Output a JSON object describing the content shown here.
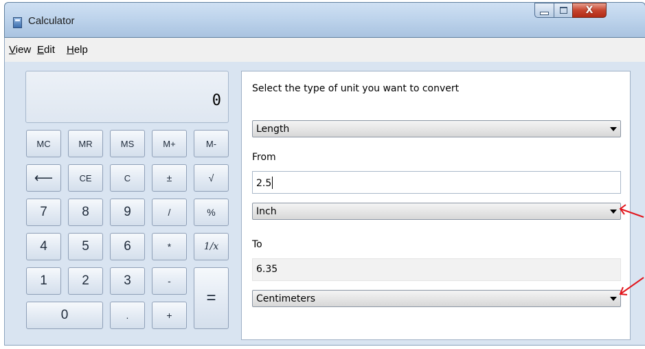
{
  "window": {
    "title": "Calculator"
  },
  "menu": [
    {
      "underline": "V",
      "rest": "iew"
    },
    {
      "underline": "E",
      "rest": "dit"
    },
    {
      "underline": "H",
      "rest": "elp"
    }
  ],
  "display": {
    "value": "0"
  },
  "keys": {
    "mc": "MC",
    "mr": "MR",
    "ms": "MS",
    "mplus": "M+",
    "mminus": "M-",
    "backspace": "⟵",
    "ce": "CE",
    "c": "C",
    "plusminus": "±",
    "sqrt": "√",
    "d7": "7",
    "d8": "8",
    "d9": "9",
    "divide": "/",
    "percent": "%",
    "d4": "4",
    "d5": "5",
    "d6": "6",
    "multiply": "*",
    "reciprocal": "1/x",
    "d1": "1",
    "d2": "2",
    "d3": "3",
    "minus": "-",
    "equals": "=",
    "d0": "0",
    "decimal": ".",
    "plus": "+"
  },
  "converter": {
    "prompt": "Select the type of unit you want to convert",
    "unit_type": "Length",
    "from_label": "From",
    "from_value": "2.5",
    "from_unit": "Inch",
    "to_label": "To",
    "to_value": "6.35",
    "to_unit": "Centimeters"
  },
  "colors": {
    "annotation_arrow": "#e2141b",
    "close_button": "#c6442e"
  },
  "icons": [
    "calculator-icon",
    "minimize-icon",
    "maximize-icon",
    "close-icon",
    "dropdown-arrow-icon"
  ]
}
